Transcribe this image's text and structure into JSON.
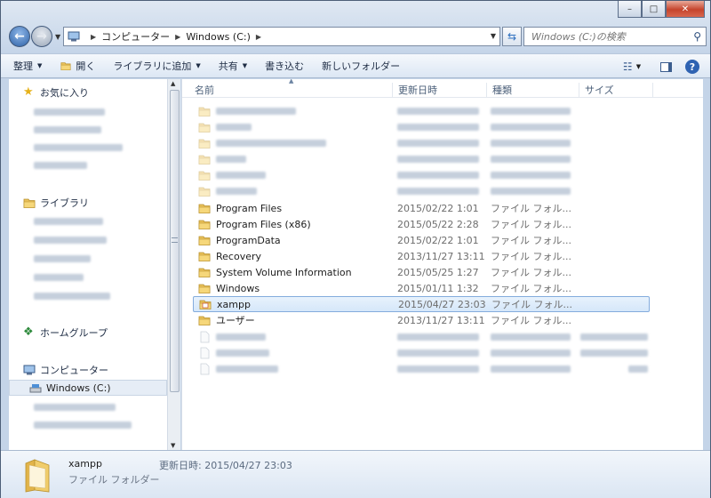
{
  "window": {
    "caption": {
      "minimize": "–",
      "maximize": "□",
      "close": "✕"
    }
  },
  "nav": {
    "back_icon": "back-arrow-icon",
    "forward_icon": "forward-arrow-icon",
    "address": {
      "computer": "コンピューター",
      "drive": "Windows (C:)"
    },
    "search_placeholder": "Windows (C:)の検索"
  },
  "toolbar": {
    "organize": "整理",
    "open": "開く",
    "include_library": "ライブラリに追加",
    "share": "共有",
    "burn": "書き込む",
    "new_folder": "新しいフォルダー",
    "help": "?"
  },
  "sidebar": {
    "favorites": "お気に入り",
    "libraries": "ライブラリ",
    "homegroup": "ホームグループ",
    "computer": "コンピューター",
    "drive_c": "Windows (C:)"
  },
  "columns": {
    "name": "名前",
    "modified": "更新日時",
    "type": "種類",
    "size": "サイズ"
  },
  "files": [
    {
      "name": "Program Files",
      "date": "2015/02/22 1:01",
      "type": "ファイル フォル..."
    },
    {
      "name": "Program Files (x86)",
      "date": "2015/05/22 2:28",
      "type": "ファイル フォル..."
    },
    {
      "name": "ProgramData",
      "date": "2015/02/22 1:01",
      "type": "ファイル フォル..."
    },
    {
      "name": "Recovery",
      "date": "2013/11/27 13:11",
      "type": "ファイル フォル..."
    },
    {
      "name": "System Volume Information",
      "date": "2015/05/25 1:27",
      "type": "ファイル フォル..."
    },
    {
      "name": "Windows",
      "date": "2015/01/11 1:32",
      "type": "ファイル フォル..."
    },
    {
      "name": "xampp",
      "date": "2015/04/27 23:03",
      "type": "ファイル フォル..."
    },
    {
      "name": "ユーザー",
      "date": "2013/11/27 13:11",
      "type": "ファイル フォル..."
    }
  ],
  "details": {
    "name": "xampp",
    "type": "ファイル フォルダー",
    "modified_label": "更新日時:",
    "modified_value": "2015/04/27 23:03"
  },
  "colors": {
    "folder": "#e9c15a",
    "selection": "#d5e7fa",
    "accent": "#2d61a6"
  }
}
